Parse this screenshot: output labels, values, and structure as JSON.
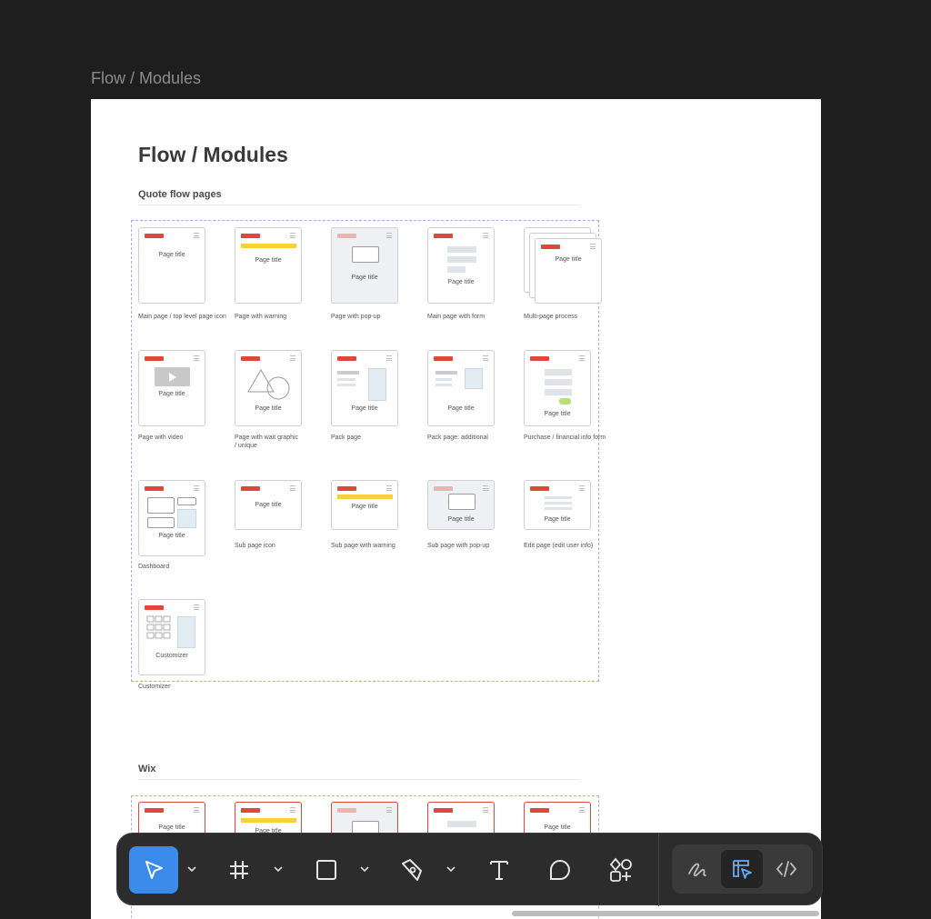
{
  "canvas": {
    "frame_label": "Flow / Modules"
  },
  "board": {
    "title": "Flow / Modules",
    "sections": [
      {
        "heading": "Quote flow pages",
        "tiles": [
          {
            "title": "Page title",
            "label": "Main page / top level page icon"
          },
          {
            "title": "Page title",
            "label": "Page with warning"
          },
          {
            "title": "Page title",
            "label": "Page with pop-up"
          },
          {
            "title": "Page title",
            "label": "Main page with form"
          },
          {
            "title": "Page title",
            "label": "Multi-page process"
          },
          {
            "title": "Page title",
            "label": "Page with video"
          },
          {
            "title": "Page title",
            "label": "Page with wait graphic / unique"
          },
          {
            "title": "Page title",
            "label": "Pack page"
          },
          {
            "title": "Page title",
            "label": "Pack page: additional"
          },
          {
            "title": "Page title",
            "label": "Purchase / financial info form"
          },
          {
            "title": "Page title",
            "label": "Dashboard"
          },
          {
            "title": "Page title",
            "label": "Sub page icon"
          },
          {
            "title": "Page title",
            "label": "Sub page with warning"
          },
          {
            "title": "Page title",
            "label": "Sub page with pop-up"
          },
          {
            "title": "Page title",
            "label": "Edit page (edit user info)"
          },
          {
            "title": "Customizer",
            "label": "Customizer"
          }
        ]
      },
      {
        "heading": "Wix",
        "tiles": [
          {
            "title": "Page title"
          },
          {
            "title": "Page title"
          },
          {
            "title": ""
          },
          {
            "title": ""
          },
          {
            "title": "Page title"
          }
        ]
      }
    ]
  },
  "toolbar": {
    "tools": [
      {
        "name": "move-tool",
        "icon": "cursor-arrow-icon",
        "active": true
      },
      {
        "name": "frame-tool",
        "icon": "hash-frame-icon"
      },
      {
        "name": "shape-tool",
        "icon": "rectangle-icon"
      },
      {
        "name": "pen-tool",
        "icon": "pen-nib-icon"
      },
      {
        "name": "text-tool",
        "icon": "text-icon"
      },
      {
        "name": "comment-tool",
        "icon": "comment-bubble-icon"
      },
      {
        "name": "actions-tool",
        "icon": "shapes-plus-icon"
      }
    ],
    "modes": [
      {
        "name": "draw-mode",
        "icon": "scribble-icon"
      },
      {
        "name": "design-mode",
        "icon": "design-cursor-icon",
        "active": true
      },
      {
        "name": "dev-mode",
        "icon": "code-brackets-icon"
      }
    ]
  },
  "colors": {
    "canvas": "#1e1e1e",
    "accent": "#3b8bea",
    "header_bar": "#e0463a",
    "warning": "#f3d23c",
    "selection": "#b6a8ee",
    "success": "#b7e07a"
  }
}
